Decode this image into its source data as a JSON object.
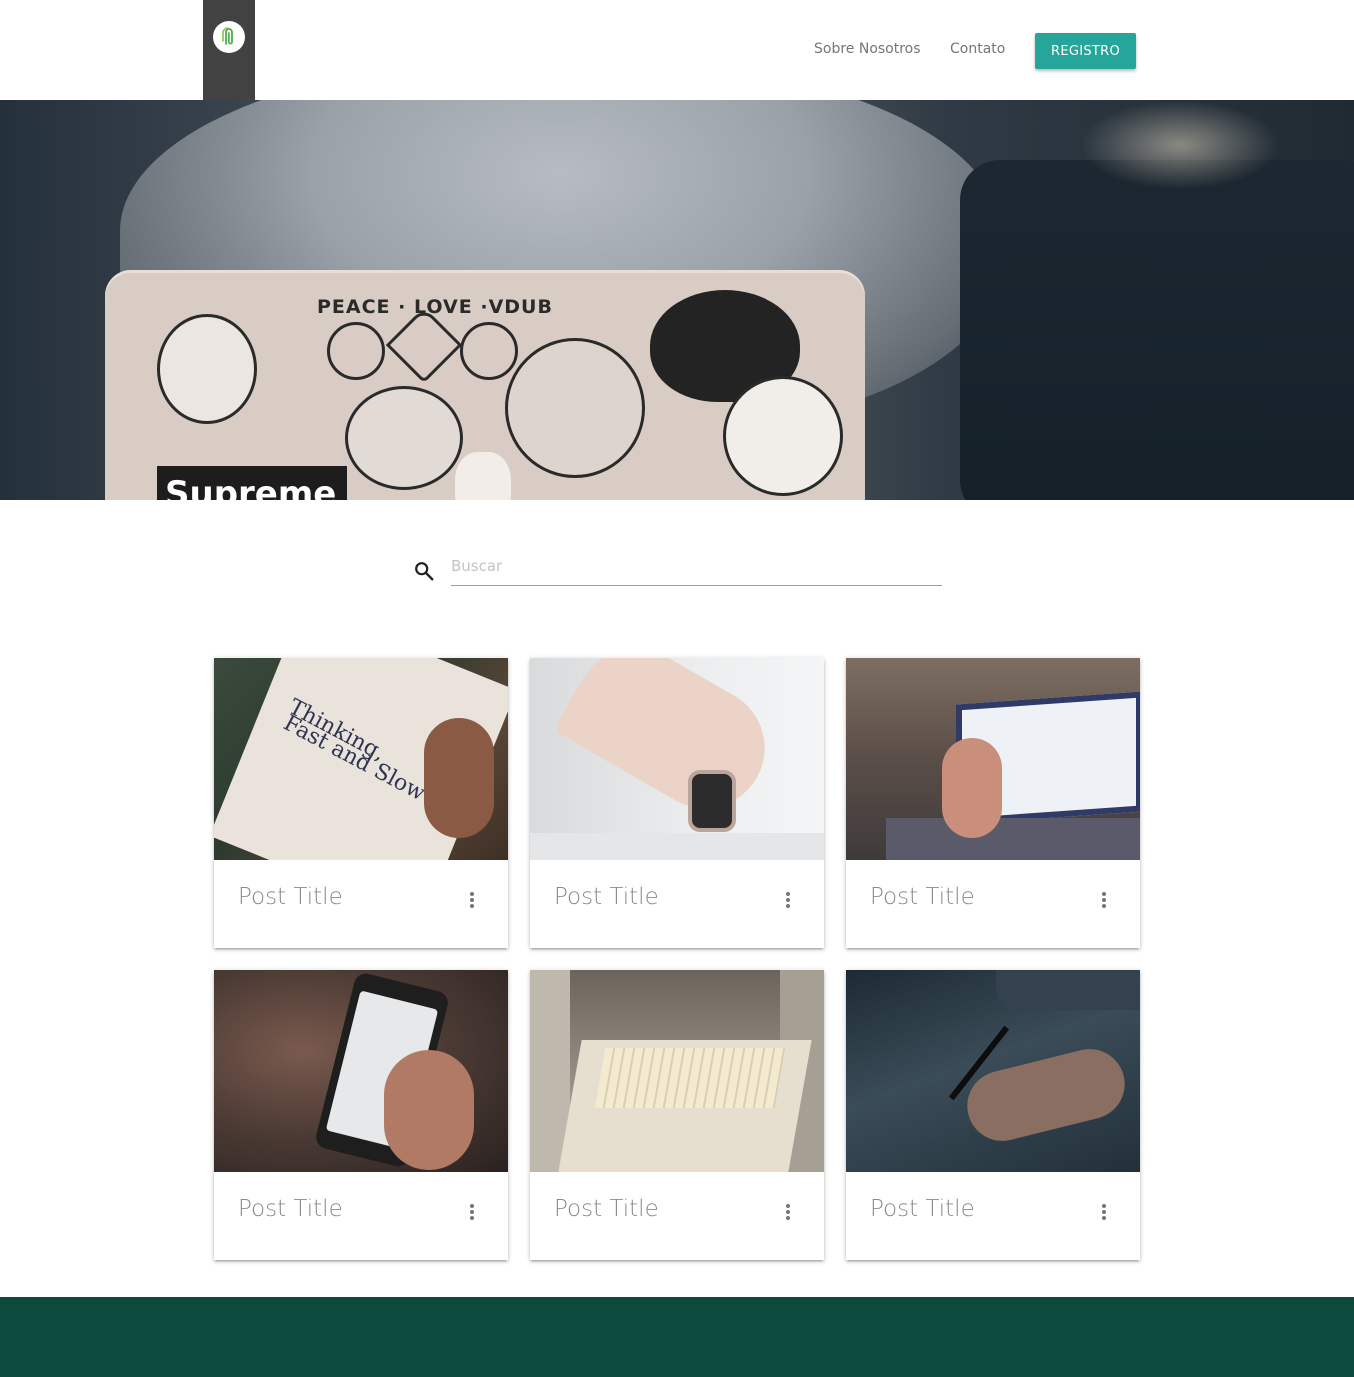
{
  "header": {
    "nav": {
      "about": "Sobre Nosotros",
      "contact": "Contato",
      "register": "REGISTRO"
    },
    "logo_icon": "paperclip-icon",
    "colors": {
      "logo_tab": "#424242",
      "register_button": "#26a69a",
      "logo_mark": "#4caf50"
    }
  },
  "hero": {
    "image": "laptop-with-stickers-photo",
    "laptop_sticker_text": "PEACE · LOVE ·VDUB",
    "laptop_brand_text": "Supreme"
  },
  "search": {
    "placeholder": "Buscar",
    "value": "",
    "icon": "search-icon"
  },
  "cards": [
    {
      "title": "Post Title",
      "image": "book-thinking-fast-and-slow-photo",
      "image_text_1": "Thinking,",
      "image_text_2": "Fast and Slow",
      "menu_icon": "more-vert-icon"
    },
    {
      "title": "Post Title",
      "image": "hand-holding-smartwatch-photo",
      "menu_icon": "more-vert-icon"
    },
    {
      "title": "Post Title",
      "image": "laptop-and-phone-charts-photo",
      "menu_icon": "more-vert-icon"
    },
    {
      "title": "Post Title",
      "image": "hands-using-phone-calculator-photo",
      "menu_icon": "more-vert-icon"
    },
    {
      "title": "Post Title",
      "image": "filing-cabinet-drawer-photo",
      "menu_icon": "more-vert-icon"
    },
    {
      "title": "Post Title",
      "image": "hand-writing-with-pen-photo",
      "menu_icon": "more-vert-icon"
    }
  ],
  "footer": {
    "color": "#0c4a3e"
  }
}
